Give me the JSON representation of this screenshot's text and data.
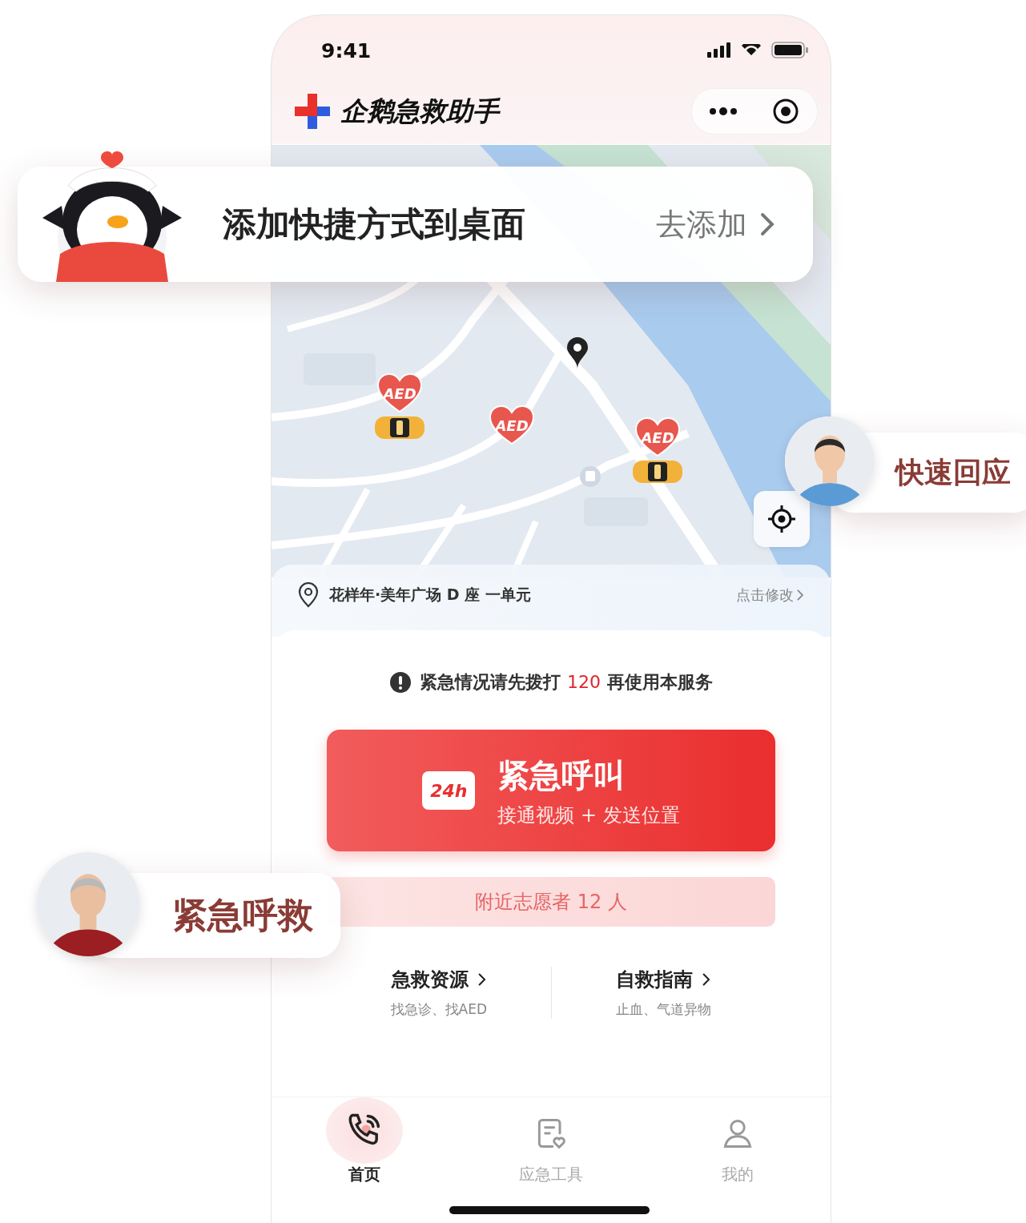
{
  "status_bar": {
    "time": "9:41"
  },
  "header": {
    "title": "企鹅急救助手"
  },
  "map": {
    "kind": "picture",
    "markers": [
      {
        "kind": "aed_car",
        "label": "AED"
      },
      {
        "kind": "aed",
        "label": "AED"
      },
      {
        "kind": "aed_car",
        "label": "AED"
      }
    ]
  },
  "address": {
    "text": "花样年·美年广场 D 座 一单元",
    "action": "点击修改"
  },
  "notice": {
    "before": "紧急情况请先拨打 ",
    "number": "120",
    "after": " 再使用本服务"
  },
  "call_button": {
    "badge": "24h",
    "title": "紧急呼叫",
    "subtitle": "接通视频 + 发送位置"
  },
  "volunteers": "附近志愿者 12 人",
  "links": [
    {
      "title": "急救资源",
      "subtitle": "找急诊、找AED"
    },
    {
      "title": "自救指南",
      "subtitle": "止血、气道异物"
    }
  ],
  "tabs": [
    {
      "kind": "call",
      "label": "首页",
      "selected": true
    },
    {
      "kind": "tools",
      "label": "应急工具",
      "selected": false
    },
    {
      "kind": "profile",
      "label": "我的",
      "selected": false
    }
  ],
  "callouts": [
    {
      "kind": "shortcut",
      "text": "添加快捷方式到桌面",
      "action": "去添加"
    },
    {
      "kind": "response",
      "text": "快速回应"
    },
    {
      "kind": "sos",
      "text": "紧急呼救"
    }
  ]
}
